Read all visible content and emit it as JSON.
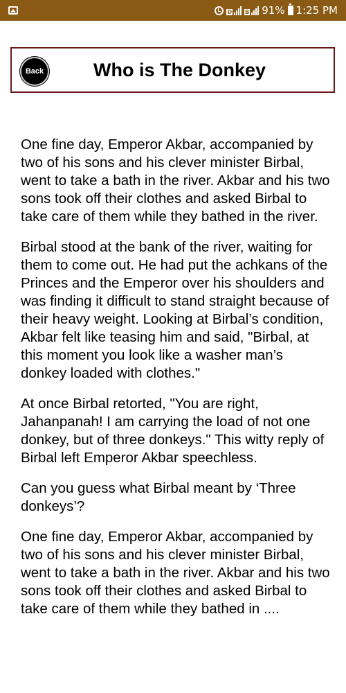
{
  "status_bar": {
    "battery_percent": "91%",
    "time": "1:25 PM",
    "icons": [
      "gallery-icon",
      "alarm-icon",
      "signal-icon",
      "signal-icon",
      "battery-icon"
    ]
  },
  "header": {
    "back_label": "Back",
    "title": "Who is The Donkey",
    "border_color": "#6b1a1a"
  },
  "story": {
    "paragraphs": [
      "One fine day, Emperor Akbar, accompanied by two of his sons and his clever minister Birbal, went to take a bath in the river. Akbar and his two sons took off their clothes and asked Birbal to take care of them while they bathed in the river.",
      "Birbal stood at the bank of the river, waiting for them to come out. He had put the achkans of the Princes and the Emperor over his shoulders and was finding it difficult to stand straight because of their heavy weight. Looking at Birbal’s condition, Akbar felt like teasing him and said, \"Birbal, at this moment you look like a washer man’s donkey loaded with clothes.\"",
      "At once Birbal retorted, \"You are right, Jahanpanah! I am carrying the load of not one donkey, but of three donkeys.\" This witty reply of Birbal left Emperor Akbar speechless.",
      "Can you guess what Birbal meant by ‘Three donkeys’?",
      "One fine day, Emperor Akbar, accompanied by two of his sons and his clever minister Birbal, went to take a bath in the river. Akbar and his two sons took off their clothes and asked Birbal to take care of them while they bathed in ...."
    ]
  },
  "colors": {
    "status_bar": "#8a5a14",
    "text": "#000000",
    "background": "#ffffff"
  }
}
